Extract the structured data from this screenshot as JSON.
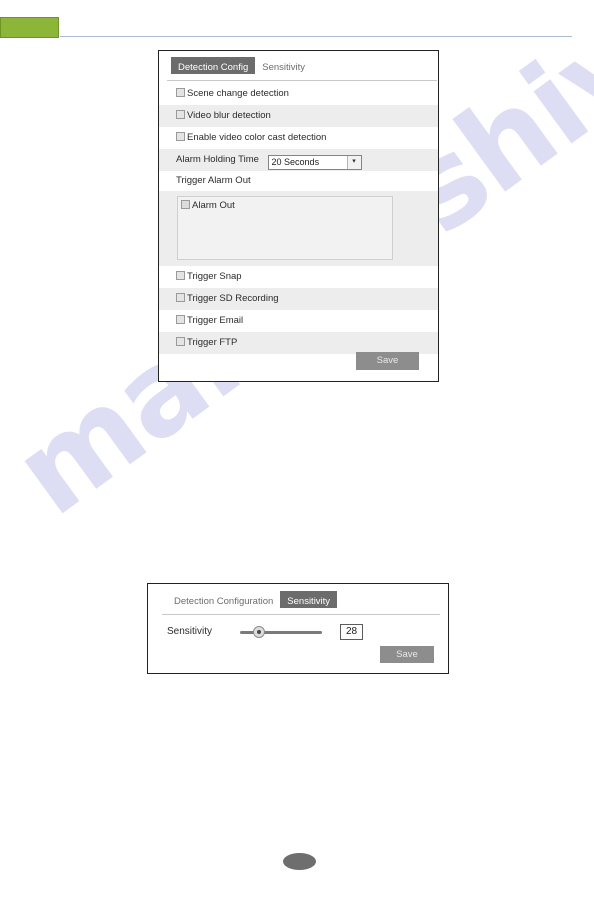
{
  "page": {
    "number_badge": "",
    "watermark_text": "manualshive.com"
  },
  "detection_panel": {
    "tabs": [
      {
        "label": "Detection Config",
        "active": true
      },
      {
        "label": "Sensitivity",
        "active": false
      }
    ],
    "rows": [
      {
        "type": "checkbox",
        "label": "Scene change detection",
        "checked": false
      },
      {
        "type": "checkbox",
        "label": "Video blur detection",
        "checked": false
      },
      {
        "type": "checkbox",
        "label": "Enable video color cast detection",
        "checked": false
      }
    ],
    "alarm_holding_time": {
      "label": "Alarm Holding Time",
      "value": "20 Seconds",
      "arrow_glyph": "▾"
    },
    "trigger_alarm_out": {
      "group_label": "Trigger Alarm Out",
      "item_label": "Alarm Out",
      "checked": false
    },
    "trigger_rows": [
      {
        "label": "Trigger Snap",
        "checked": false
      },
      {
        "label": "Trigger SD Recording",
        "checked": false
      },
      {
        "label": "Trigger Email",
        "checked": false
      },
      {
        "label": "Trigger FTP",
        "checked": false
      }
    ],
    "save_label": "Save"
  },
  "sensitivity_panel": {
    "tabs": [
      {
        "label": "Detection Configuration",
        "active": false
      },
      {
        "label": "Sensitivity",
        "active": true
      }
    ],
    "sensitivity": {
      "label": "Sensitivity",
      "value": "28"
    },
    "save_label": "Save"
  },
  "colors": {
    "green_tab": "#8cb638",
    "active_tab": "#6c6c6c",
    "save_button": "#8d8d8d",
    "row_alt": "#ededed",
    "header_rule": "#a8bdd4",
    "watermark": "#c9caee"
  }
}
